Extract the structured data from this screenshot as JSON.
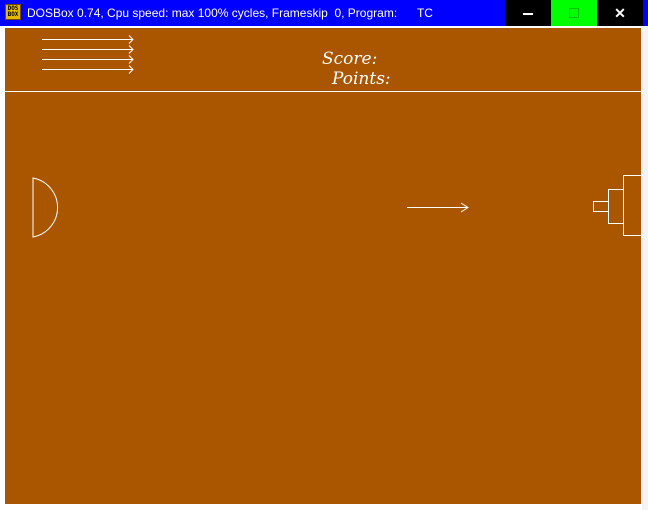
{
  "window": {
    "title": "DOSBox 0.74, Cpu speed: max 100% cycles, Frameskip  0, Program:      TC",
    "app_icon_text": "DOS BOX",
    "minimize_icon": "minimize-icon",
    "maximize_icon": "maximize-icon",
    "close_icon": "close-icon",
    "close_glyph": "✕",
    "colors": {
      "titlebar": "#0000ff",
      "maximize_button": "#00ff00",
      "game_background": "#aa5500",
      "game_lines": "#ffffff"
    }
  },
  "game": {
    "score_label": "Score:",
    "points_label": "Points:",
    "arrows_remaining": 4
  }
}
